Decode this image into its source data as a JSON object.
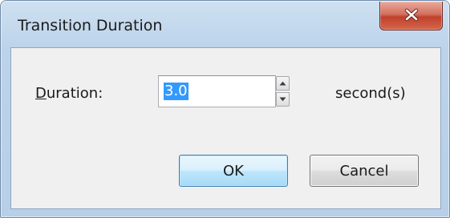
{
  "window": {
    "title": "Transition Duration",
    "close_icon": "close-x-icon"
  },
  "form": {
    "duration_label_mnemonic": "D",
    "duration_label_rest": "uration:",
    "duration_value": "3.0",
    "unit": "second(s)",
    "spin_up_icon": "up-arrow-icon",
    "spin_down_icon": "down-arrow-icon"
  },
  "buttons": {
    "ok": "OK",
    "cancel": "Cancel"
  },
  "colors": {
    "selection": "#3399ff",
    "close_button": "#c0412c",
    "default_button_border": "#3c7fb1"
  }
}
